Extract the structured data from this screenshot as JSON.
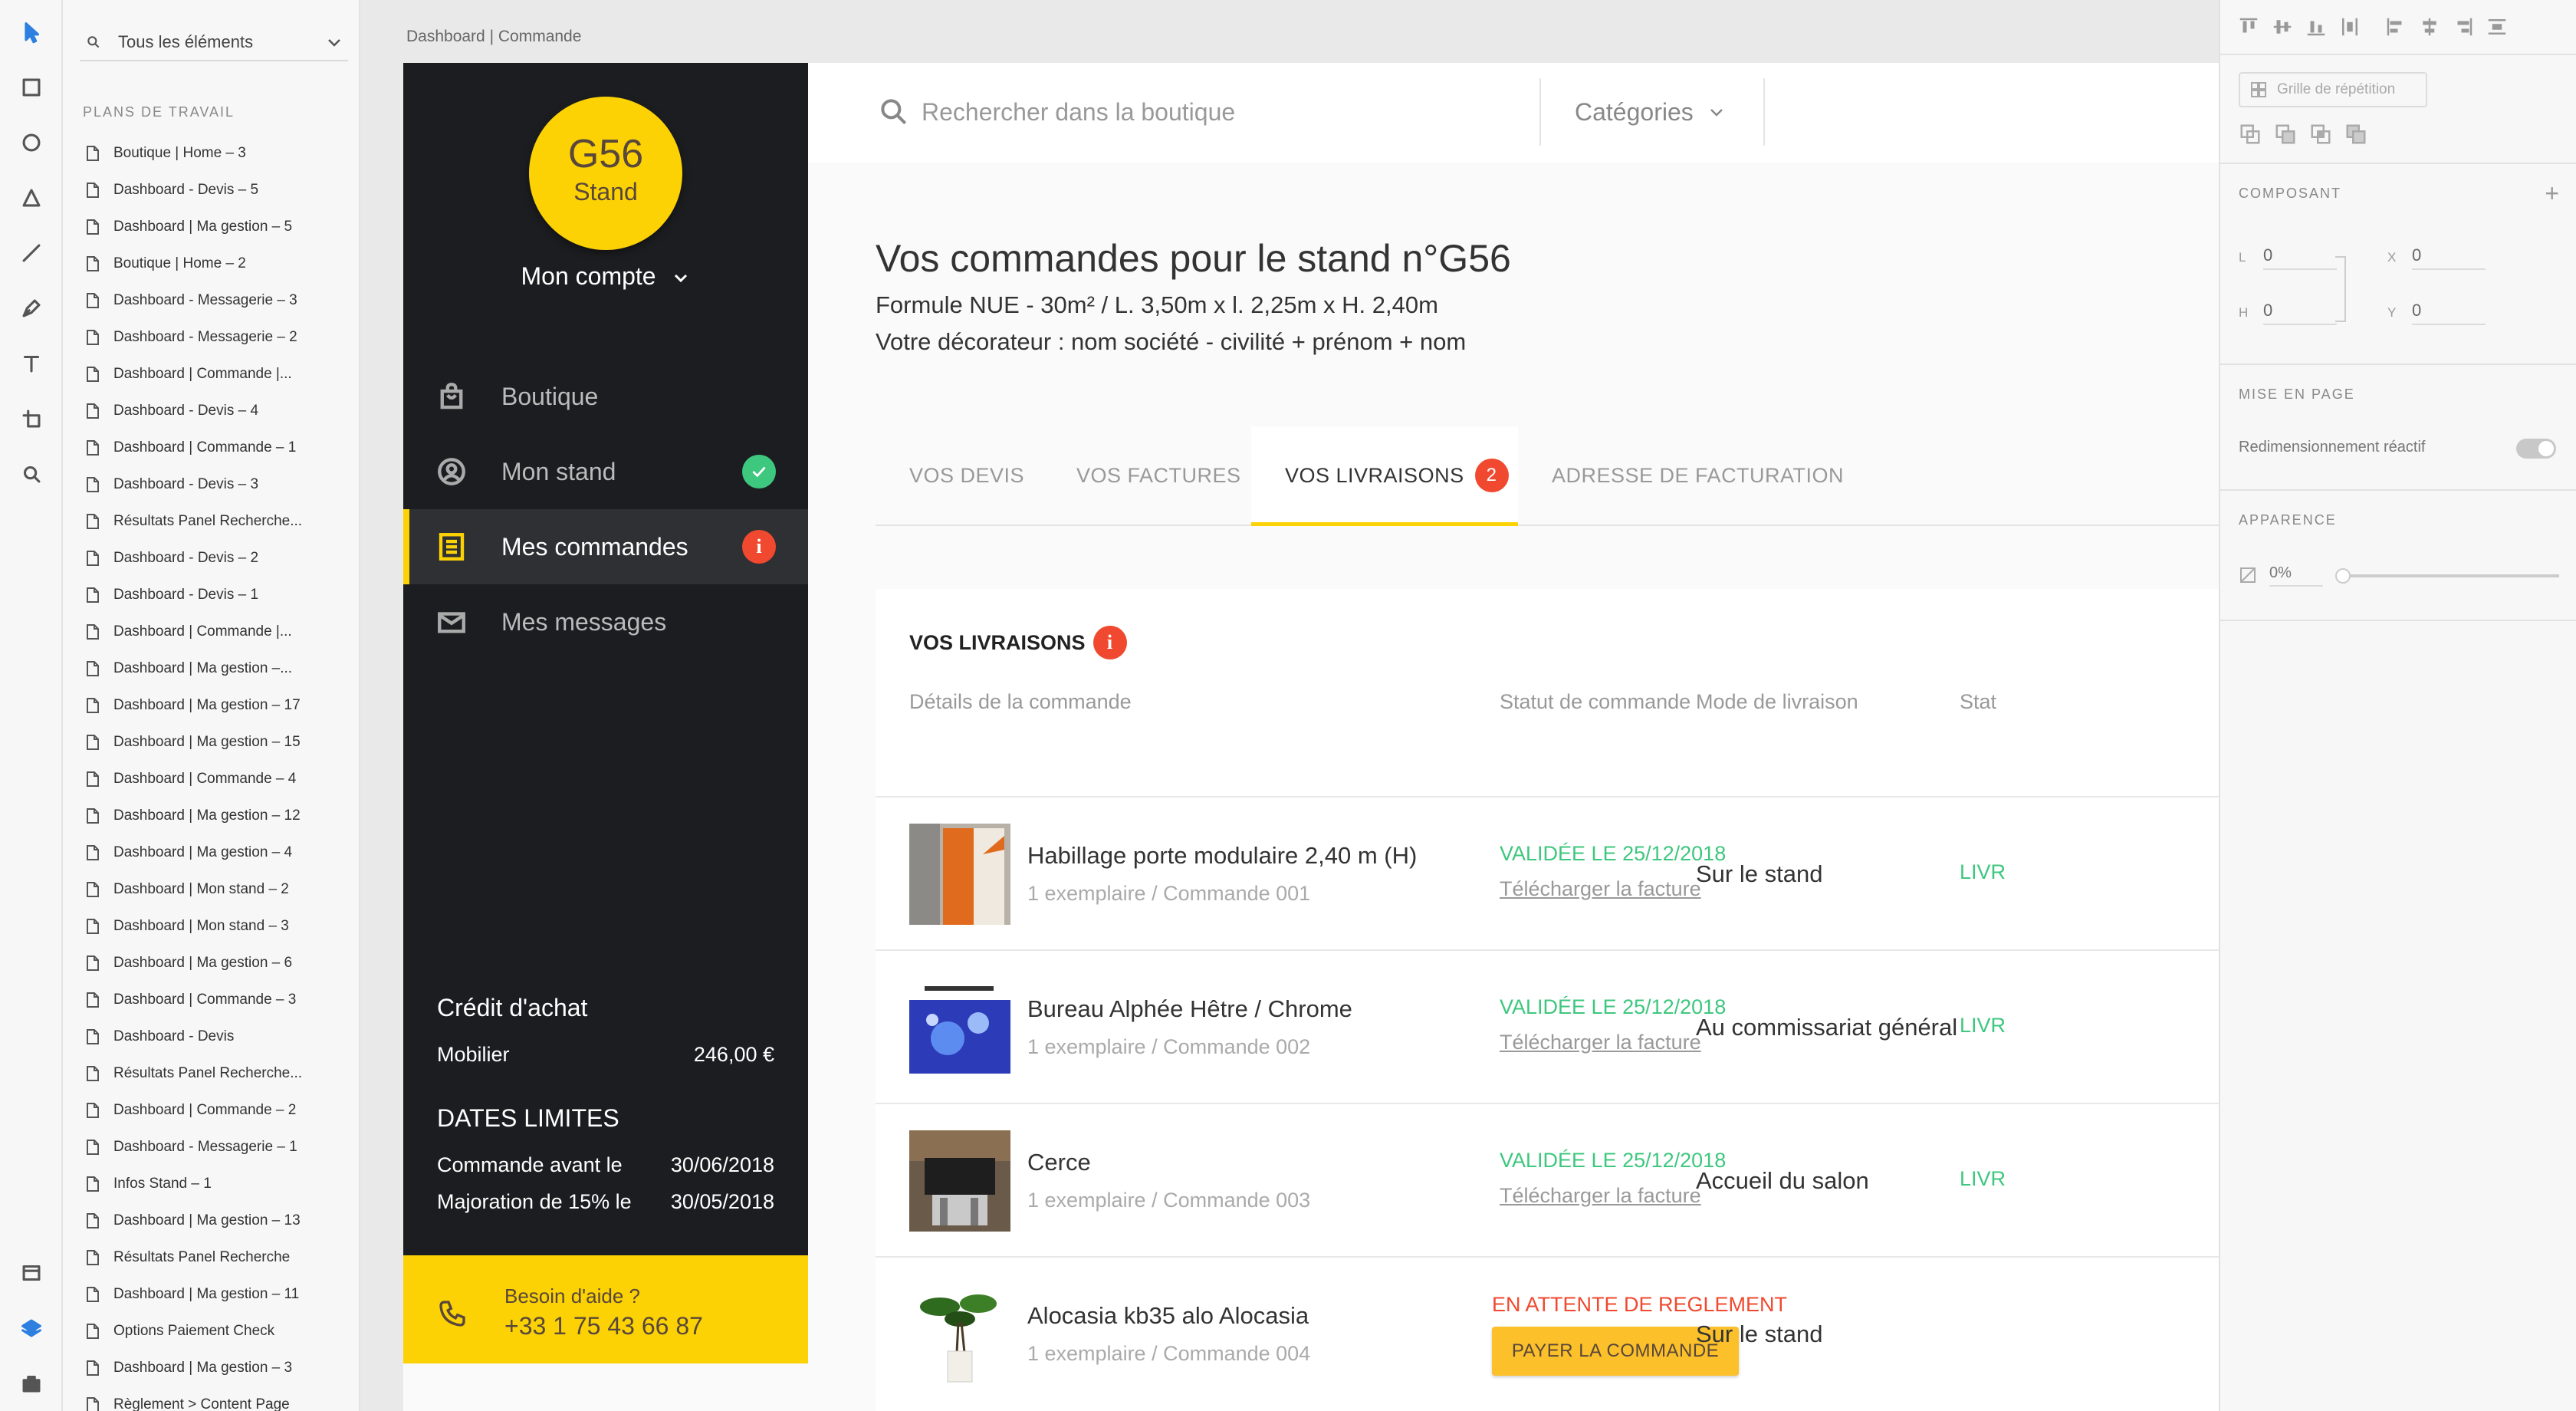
{
  "editor": {
    "canvas_label": "Dashboard | Commande",
    "layers": {
      "filter_label": "Tous les éléments",
      "heading": "PLANS DE TRAVAIL",
      "items": [
        "Boutique | Home – 3",
        "Dashboard - Devis – 5",
        "Dashboard | Ma gestion – 5",
        "Boutique | Home – 2",
        "Dashboard - Messagerie – 3",
        "Dashboard - Messagerie – 2",
        "Dashboard | Commande |...",
        "Dashboard - Devis – 4",
        "Dashboard | Commande – 1",
        "Dashboard - Devis – 3",
        "Résultats Panel Recherche...",
        "Dashboard - Devis – 2",
        "Dashboard - Devis – 1",
        "Dashboard | Commande |...",
        "Dashboard | Ma gestion –...",
        "Dashboard | Ma gestion – 17",
        "Dashboard | Ma gestion – 15",
        "Dashboard | Commande – 4",
        "Dashboard | Ma gestion – 12",
        "Dashboard | Ma gestion – 4",
        "Dashboard | Mon stand – 2",
        "Dashboard | Mon stand – 3",
        "Dashboard | Ma gestion – 6",
        "Dashboard | Commande – 3",
        "Dashboard - Devis",
        "Résultats Panel Recherche...",
        "Dashboard | Commande – 2",
        "Dashboard - Messagerie – 1",
        "Infos Stand – 1",
        "Dashboard | Ma gestion – 13",
        "Résultats Panel Recherche",
        "Dashboard | Ma gestion – 11",
        "Options Paiement Check",
        "Dashboard | Ma gestion – 3",
        "Règlement > Content Page"
      ]
    },
    "tools": [
      "select-tool",
      "rectangle-tool",
      "ellipse-tool",
      "triangle-tool",
      "line-tool",
      "pen-tool",
      "text-tool",
      "artboard-tool",
      "zoom-tool"
    ],
    "inspector": {
      "repeat_grid_label": "Grille de répétition",
      "component_heading": "COMPOSANT",
      "w_label": "L",
      "w_value": "0",
      "x_label": "X",
      "x_value": "0",
      "h_label": "H",
      "h_value": "0",
      "y_label": "Y",
      "y_value": "0",
      "layout_heading": "MISE EN PAGE",
      "responsive_label": "Redimensionnement réactif",
      "appearance_heading": "APPARENCE",
      "opacity_value": "0%"
    }
  },
  "app": {
    "brand": {
      "stand_code": "G56",
      "stand_label": "Stand"
    },
    "account_label": "Mon compte",
    "nav": [
      {
        "label": "Boutique",
        "icon": "shopping-bag-icon"
      },
      {
        "label": "Mon stand",
        "icon": "user-circle-icon",
        "badge": "check"
      },
      {
        "label": "Mes commandes",
        "icon": "list-icon",
        "badge": "i"
      },
      {
        "label": "Mes messages",
        "icon": "mail-icon"
      }
    ],
    "credit": {
      "title": "Crédit d'achat",
      "label": "Mobilier",
      "value": "246,00 €"
    },
    "dates": {
      "title": "DATES LIMITES",
      "rows": [
        {
          "label": "Commande avant le",
          "value": "30/06/2018"
        },
        {
          "label": "Majoration de 15% le",
          "value": "30/05/2018"
        }
      ]
    },
    "help": {
      "title": "Besoin d'aide ?",
      "phone": "+33 1 75 43 66 87"
    },
    "search": {
      "placeholder": "Rechercher dans la boutique"
    },
    "categories_label": "Catégories",
    "title": "Vos commandes pour le stand n°G56",
    "subtitle1": "Formule NUE - 30m² / L. 3,50m x l. 2,25m x H. 2,40m",
    "subtitle2": "Votre décorateur : nom société - civilité + prénom + nom",
    "tabs": [
      {
        "label": "VOS DEVIS"
      },
      {
        "label": "VOS FACTURES"
      },
      {
        "label": "VOS LIVRAISONS",
        "badge": "2"
      },
      {
        "label": "ADRESSE DE FACTURATION"
      }
    ],
    "card": {
      "title": "VOS LIVRAISONS",
      "badge": "i",
      "columns": [
        "Détails de la commande",
        "Statut de commande",
        "Mode de livraison",
        "Stat"
      ],
      "rows": [
        {
          "name": "Habillage porte modulaire 2,40 m (H)",
          "meta": "1 exemplaire / Commande 001",
          "status": "VALIDÉE LE 25/12/2018",
          "download": "Télécharger la facture",
          "mode": "Sur le stand",
          "delivery": "LIVR"
        },
        {
          "name": "Bureau Alphée Hêtre / Chrome",
          "meta": "1 exemplaire / Commande 002",
          "status": "VALIDÉE LE 25/12/2018",
          "download": "Télécharger la facture",
          "mode": "Au commissariat général",
          "delivery": "LIVR"
        },
        {
          "name": "Cerce",
          "meta": "1 exemplaire / Commande 003",
          "status": "VALIDÉE LE 25/12/2018",
          "download": "Télécharger la facture",
          "mode": "Accueil du salon",
          "delivery": "LIVR"
        },
        {
          "name": "Alocasia kb35 alo Alocasia",
          "meta": "1 exemplaire / Commande 004",
          "status": "EN ATTENTE DE REGLEMENT",
          "action": "PAYER LA COMMANDE",
          "mode": "Sur le stand"
        }
      ]
    }
  },
  "colors": {
    "accent": "#fcd205",
    "success": "#3ec77e",
    "danger": "#f0492f",
    "sidebar": "#1c1d20"
  }
}
